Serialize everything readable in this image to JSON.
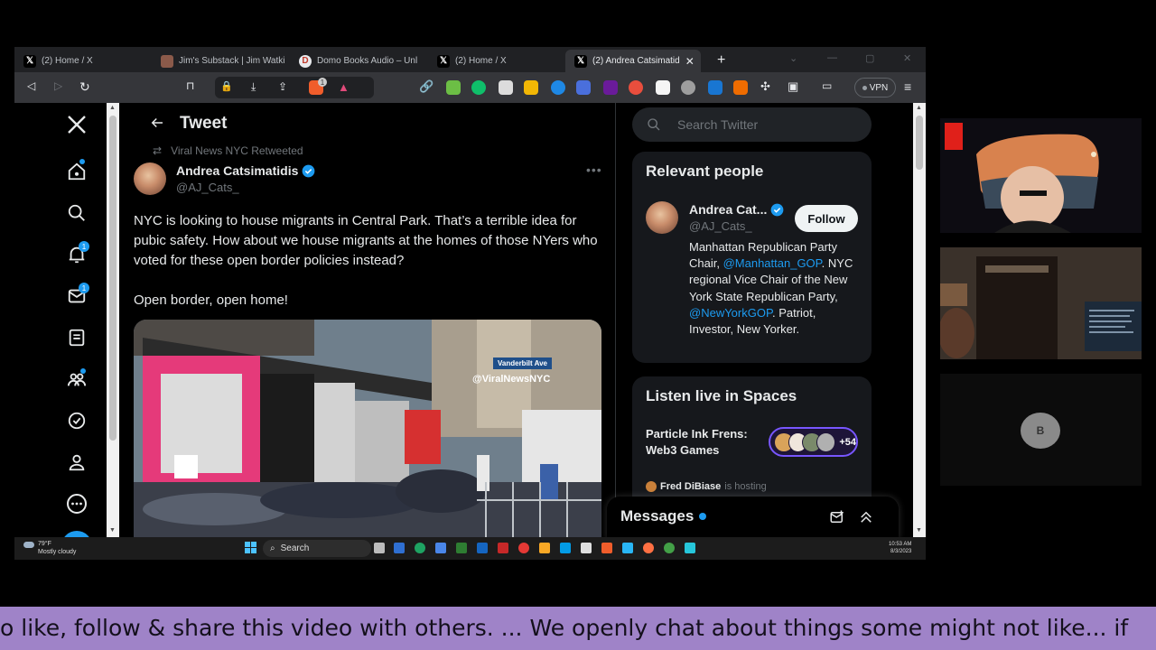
{
  "browser": {
    "tabs": [
      {
        "label": "(2) Home / X",
        "favicon": "X",
        "active": false
      },
      {
        "label": "Jim's Substack | Jim Watki",
        "favicon": "substack",
        "active": false
      },
      {
        "label": "Domo Books Audio – Unl",
        "favicon": "D",
        "active": false
      },
      {
        "label": "(2) Home / X",
        "favicon": "X",
        "active": false
      },
      {
        "label": "(2) Andrea Catsimatid",
        "favicon": "X",
        "active": true
      }
    ],
    "shield_count": "1",
    "vpn_label": "VPN"
  },
  "twitter": {
    "header_title": "Tweet",
    "retweeted_by": "Viral News NYC Retweeted",
    "author_name": "Andrea Catsimatidis",
    "author_handle": "@AJ_Cats_",
    "tweet_text_1": "NYC is looking to house migrants in Central Park. That’s a terrible idea for pubic safety. How about we house migrants at the homes of those NYers who voted for these open border policies instead?",
    "tweet_text_2": "Open border, open home!",
    "image_watermark": "@ViralNewsNYC",
    "image_sign": "Vanderbilt Ave",
    "nav_badges": {
      "notifications": "1",
      "messages": "1"
    },
    "search_placeholder": "Search Twitter",
    "relevant": {
      "title": "Relevant people",
      "name": "Andrea Cat...",
      "handle": "@AJ_Cats_",
      "follow_label": "Follow",
      "bio_1": "Manhattan Republican Party Chair, ",
      "bio_link_1": "@Manhattan_GOP",
      "bio_2": ". NYC regional Vice Chair of the New York State Republican Party, ",
      "bio_link_2": "@NewYorkGOP",
      "bio_3": ". Patriot, Investor, New Yorker."
    },
    "spaces": {
      "title": "Listen live in Spaces",
      "space_name": "Particle Ink Frens: Web3 Games",
      "listener_count": "+54",
      "host_name": "Fred DiBiase",
      "host_suffix": "is hosting"
    },
    "messages_title": "Messages"
  },
  "taskbar": {
    "weather_temp": "79°F",
    "weather_desc": "Mostly cloudy",
    "search_label": "Search",
    "time": "10:53 AM",
    "date": "8/3/2023"
  },
  "webcam": {
    "avatar_letter": "B"
  },
  "ticker": {
    "text": "o like, follow & share this video with others.  ...  We openly chat about things some might not like... if"
  },
  "colors": {
    "accent": "#1d9bf0",
    "background": "#000000",
    "ticker_bg": "#9f83c8",
    "spaces_purple": "#7856ff"
  }
}
